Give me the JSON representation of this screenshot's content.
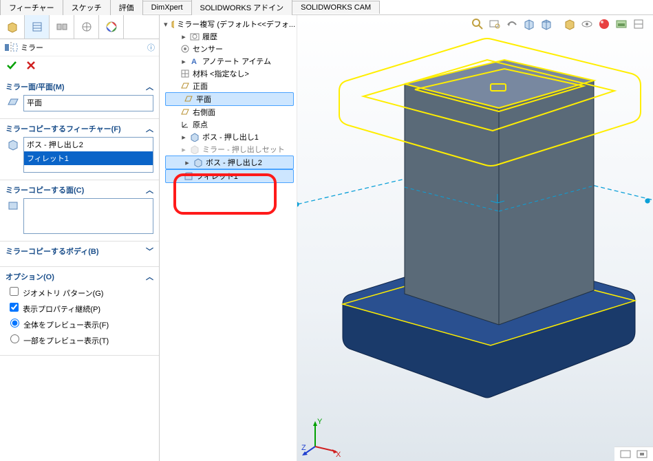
{
  "tabs": [
    "フィーチャー",
    "スケッチ",
    "評価",
    "DimXpert",
    "SOLIDWORKS アドイン",
    "SOLIDWORKS CAM"
  ],
  "pm": {
    "title": "ミラー",
    "sections": {
      "plane": {
        "label": "ミラー面/平面(M)",
        "value": "平面"
      },
      "feat": {
        "label": "ミラーコピーするフィーチャー(F)",
        "items": [
          "ボス - 押し出し2",
          "フィレット1"
        ]
      },
      "face": {
        "label": "ミラーコピーする面(C)"
      },
      "body": {
        "label": "ミラーコピーするボディ(B)"
      },
      "opt": {
        "label": "オプション(O)",
        "geom": "ジオメトリ パターン(G)",
        "vis": "表示プロパティ継続(P)",
        "full": "全体をプレビュー表示(F)",
        "part": "一部をプレビュー表示(T)"
      }
    }
  },
  "tree": {
    "root": "ミラー複写 (デフォルト<<デフォ...",
    "history": "履歴",
    "sensor": "センサー",
    "annot": "アノテート アイテム",
    "material": "材料 <指定なし>",
    "front": "正面",
    "plane": "平面",
    "right": "右側面",
    "origin": "原点",
    "boss1": "ボス - 押し出し1",
    "boss1b": "ミラー - 押し出しセット",
    "boss2": "ボス - 押し出し2",
    "fillet1": "フィレット1"
  },
  "axis": {
    "x": "X",
    "y": "Y",
    "z": "Z"
  }
}
